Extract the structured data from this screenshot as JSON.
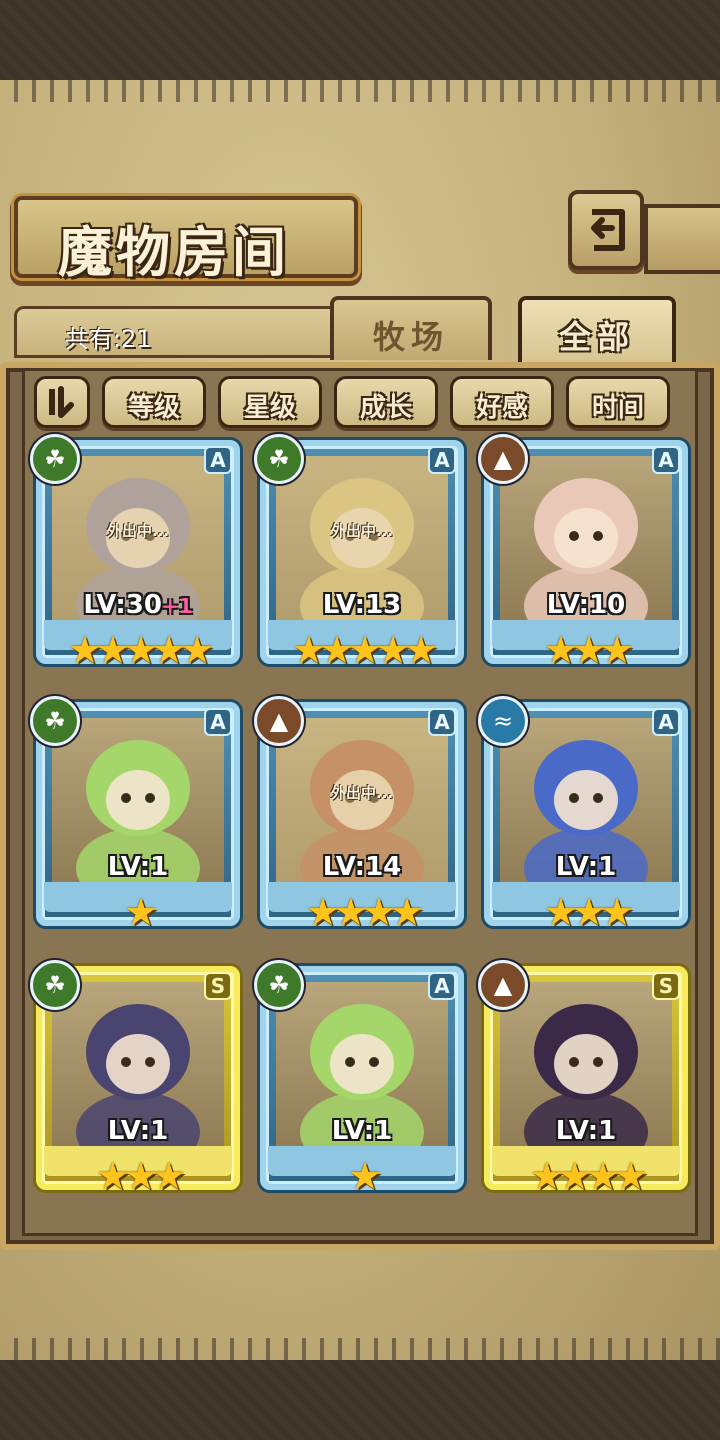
{
  "title": "魔物房间",
  "count_label": "共有:21",
  "tabs": [
    {
      "label": "牧场",
      "active": false
    },
    {
      "label": "全部",
      "active": true
    }
  ],
  "filters": [
    "等级",
    "星级",
    "成长",
    "好感",
    "时间"
  ],
  "sort_icon": "sort-toggle-icon",
  "back_icon": "return-arrow-icon",
  "monsters": [
    {
      "element": "nature",
      "rank": "A",
      "level": "LV:30",
      "bonus": "+1",
      "stars": 5,
      "status": "外出中...",
      "frame": "blue",
      "hue": "#8a83a8"
    },
    {
      "element": "nature",
      "rank": "A",
      "level": "LV:13",
      "bonus": "",
      "stars": 5,
      "status": "外出中...",
      "frame": "blue",
      "hue": "#d9c47a"
    },
    {
      "element": "earth",
      "rank": "A",
      "level": "LV:10",
      "bonus": "",
      "stars": 3,
      "status": "",
      "frame": "blue",
      "hue": "#e9c8b8"
    },
    {
      "element": "nature",
      "rank": "A",
      "level": "LV:1",
      "bonus": "",
      "stars": 1,
      "status": "",
      "frame": "blue",
      "hue": "#a5d66a"
    },
    {
      "element": "earth",
      "rank": "A",
      "level": "LV:14",
      "bonus": "",
      "stars": 4,
      "status": "外出中...",
      "frame": "blue",
      "hue": "#b4654a"
    },
    {
      "element": "water",
      "rank": "A",
      "level": "LV:1",
      "bonus": "",
      "stars": 3,
      "status": "",
      "frame": "blue",
      "hue": "#4a6ac8"
    },
    {
      "element": "nature",
      "rank": "S",
      "level": "LV:1",
      "bonus": "",
      "stars": 3,
      "status": "",
      "frame": "gold",
      "hue": "#4a4470"
    },
    {
      "element": "nature",
      "rank": "A",
      "level": "LV:1",
      "bonus": "",
      "stars": 1,
      "status": "",
      "frame": "blue",
      "hue": "#a5d66a"
    },
    {
      "element": "earth",
      "rank": "S",
      "level": "LV:1",
      "bonus": "",
      "stars": 4,
      "status": "",
      "frame": "gold",
      "hue": "#3a2a48"
    }
  ]
}
